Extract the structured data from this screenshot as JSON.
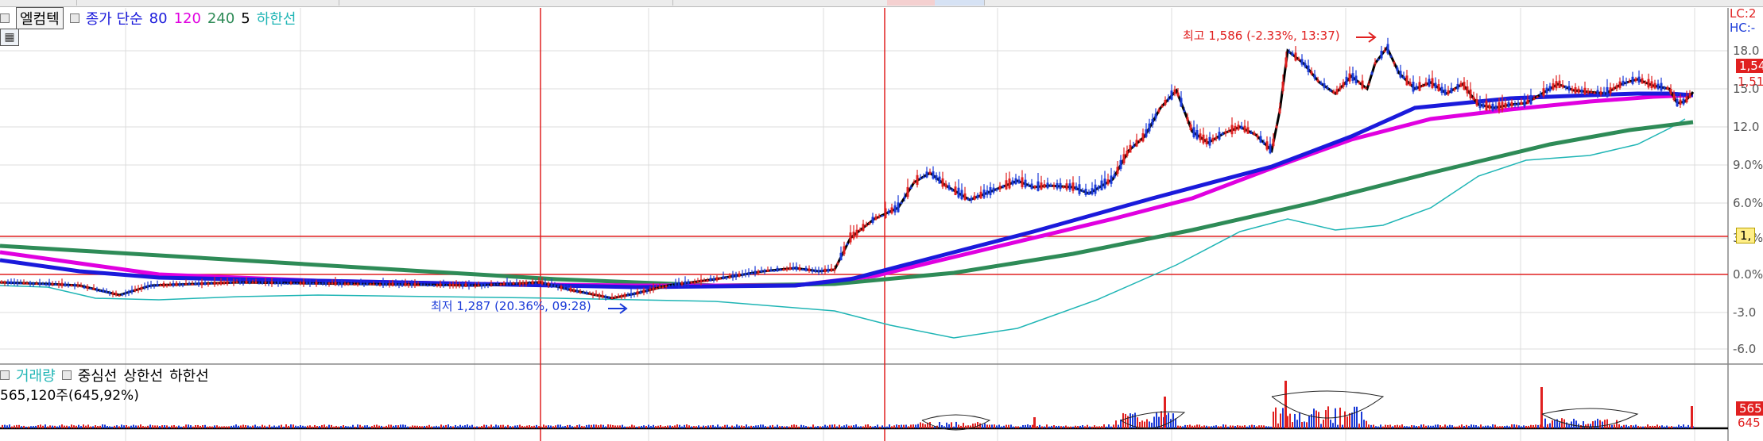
{
  "top_legend": {
    "indicator_name": "엘컴텍",
    "ma_label": "종가 단순",
    "periods": [
      "80",
      "120",
      "240",
      "5"
    ],
    "lower_band_label": "하한선",
    "colors": {
      "ma80": "#1a1adb",
      "ma120": "#e000e0",
      "ma240": "#2e8b57",
      "ma5": "#000000",
      "lower_band": "#1fb5b5",
      "price_up": "#e02020",
      "price_down": "#1a3ad8"
    }
  },
  "annotations": {
    "high": "최고 1,586 (-2.33%, 13:37)",
    "low": "최저 1,287 (20.36%, 09:28)"
  },
  "right_axis": {
    "top_labels": [
      "LC:2",
      "HC:-"
    ],
    "ticks": [
      "18.0",
      "15.0",
      "12.0",
      "9.0%",
      "6.0%",
      "3.0%",
      "0.0%",
      "-3.0",
      "-6.0"
    ],
    "price_tag_1": "1,54",
    "price_tag_2": "1,51",
    "ref_tag": "1,",
    "vol_tag_1": "565",
    "vol_tag_2": "645"
  },
  "volume_legend": {
    "title": "거래량",
    "center": "중심선",
    "upper": "상한선",
    "lower": "하한선",
    "value": "565,120주(645,92%)"
  }
}
